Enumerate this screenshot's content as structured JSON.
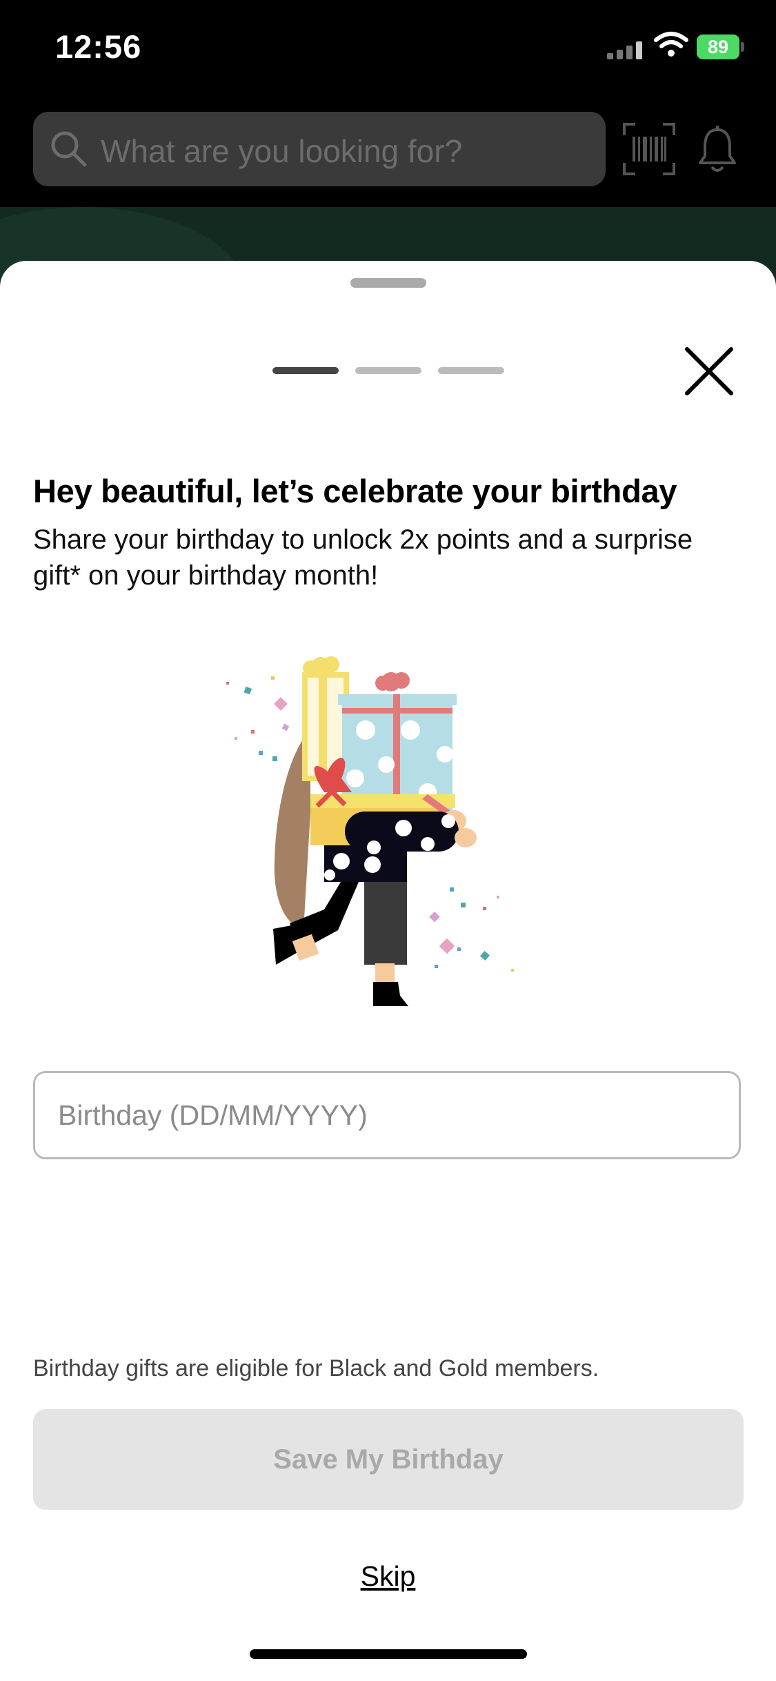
{
  "status_bar": {
    "time": "12:56",
    "battery_level": "89",
    "icons": [
      "signal-icon",
      "wifi-icon",
      "battery-icon"
    ]
  },
  "header": {
    "search_placeholder": "What are you looking for?",
    "icons": [
      "search-icon",
      "barcode-scan-icon",
      "bell-icon"
    ]
  },
  "sheet": {
    "progress": {
      "total_steps": 3,
      "current_step": 1
    },
    "headline": "Hey beautiful, let’s celebrate your birthday",
    "subtext": "Share your birthday to unlock 2x points and a surprise gift* on your birthday month!",
    "birthday_input": {
      "placeholder": "Birthday (DD/MM/YYYY)",
      "value": ""
    },
    "eligibility_note": "Birthday gifts are eligible for Black and Gold members.",
    "save_label": "Save My Birthday",
    "skip_label": "Skip"
  },
  "colors": {
    "primary_disabled_bg": "#e4e4e4",
    "primary_disabled_text": "#a9a9a9",
    "battery_green": "#4cd964",
    "app_dark": "#000000"
  }
}
